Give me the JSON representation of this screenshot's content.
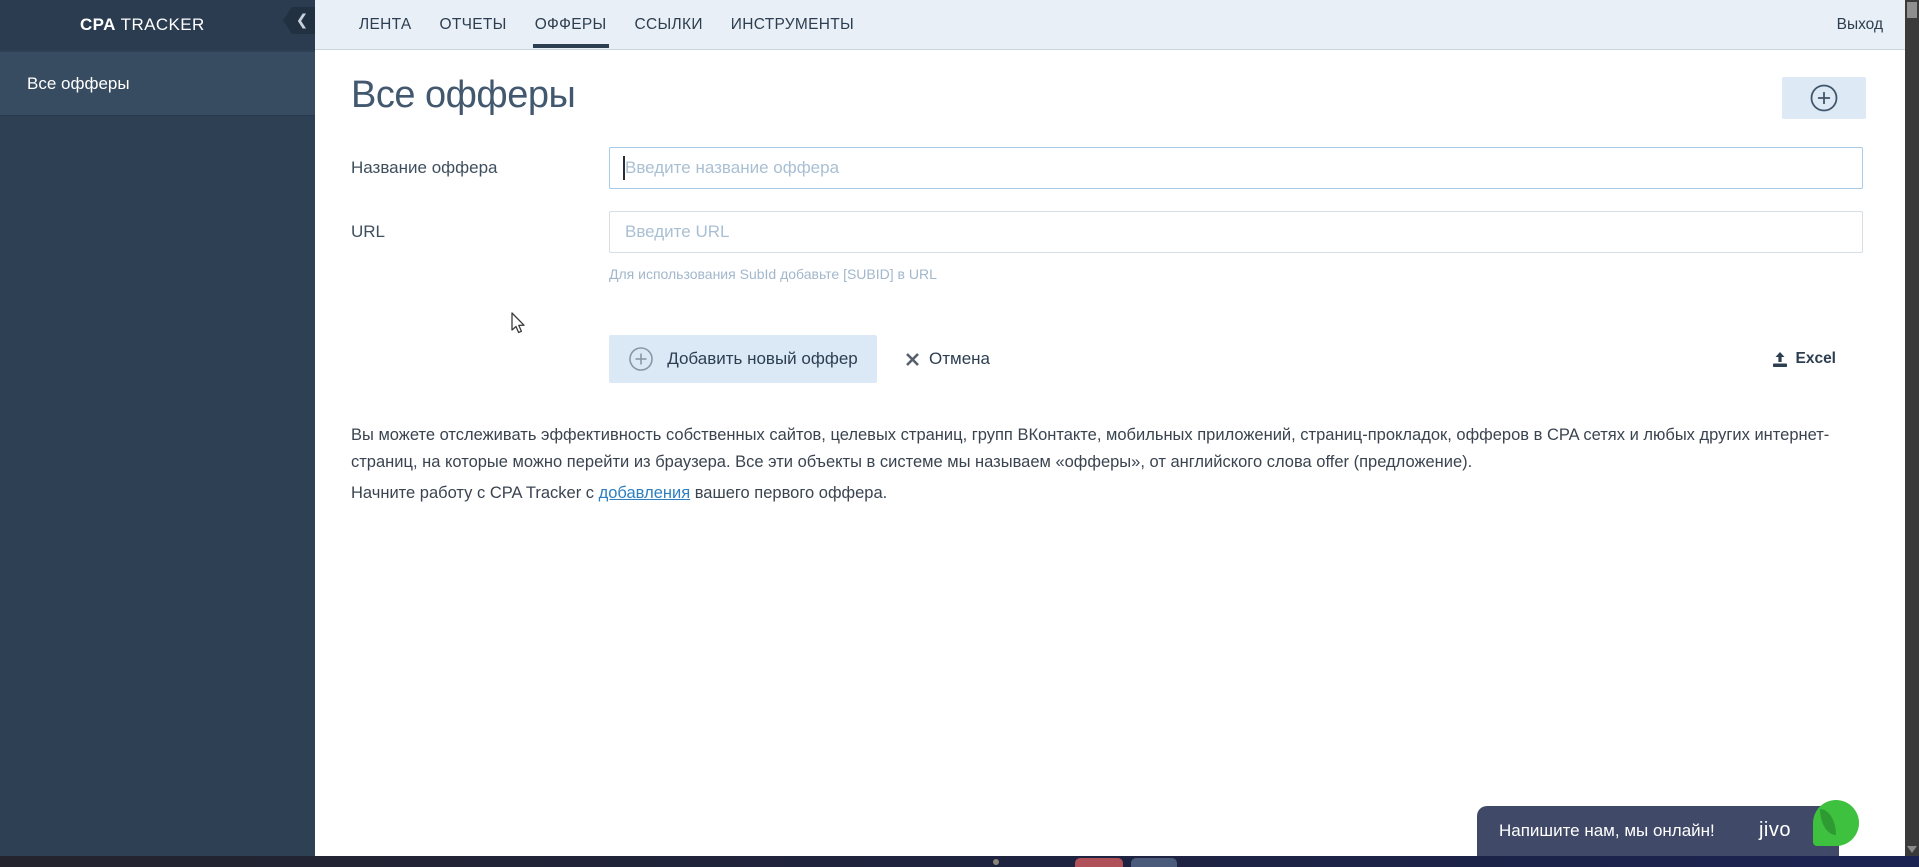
{
  "brand": {
    "bold": "CPA",
    "rest": " TRACKER"
  },
  "topnav": {
    "tabs": [
      "ЛЕНТА",
      "ОТЧЕТЫ",
      "ОФФЕРЫ",
      "ССЫЛКИ",
      "ИНСТРУМЕНТЫ"
    ],
    "active_tab": "ОФФЕРЫ",
    "logout_label": "Выход"
  },
  "sidebar": {
    "items": [
      "Все офферы"
    ]
  },
  "main": {
    "title": "Все офферы",
    "form": {
      "name_label": "Название оффера",
      "name_placeholder": "Введите название оффера",
      "name_value": "",
      "url_label": "URL",
      "url_placeholder": "Введите URL",
      "url_value": "",
      "url_hint": "Для использования SubId добавьте [SUBID] в URL",
      "submit_label": "Добавить новый оффер",
      "cancel_label": "Отмена",
      "excel_label": "Excel"
    },
    "paragraph1": "Вы можете отслеживать эффективность собственных сайтов, целевых страниц, групп ВКонтакте, мобильных приложений, страниц-прокладок, офферов в CPA сетях и любых других интернет-страниц, на которые можно перейти из браузера. Все эти объекты в системе мы называем «офферы», от английского слова offer (предложение).",
    "paragraph2": {
      "before": "Начните работу с CPA Tracker с ",
      "link": "добавления",
      "after": " вашего первого оффера."
    }
  },
  "chat": {
    "message": "Напишите нам, мы онлайн!",
    "brand": "jivo",
    "online_color": "#3ec13e"
  },
  "colors": {
    "sidebar_bg": "#2e4154",
    "sidebar_active_bg": "#384c61",
    "topbar_left_bg": "#2b3c50",
    "topnav_bg": "#e9eff6",
    "accent_button_bg": "#dbe9f6",
    "link": "#2d7fc1",
    "chat_bg": "#404a68"
  }
}
